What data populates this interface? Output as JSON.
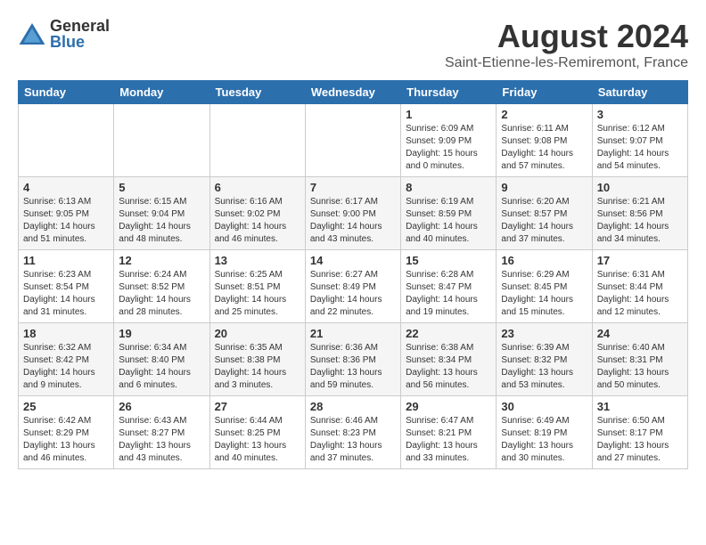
{
  "logo": {
    "general": "General",
    "blue": "Blue"
  },
  "title": "August 2024",
  "location": "Saint-Etienne-les-Remiremont, France",
  "days_of_week": [
    "Sunday",
    "Monday",
    "Tuesday",
    "Wednesday",
    "Thursday",
    "Friday",
    "Saturday"
  ],
  "weeks": [
    [
      {
        "day": "",
        "info": ""
      },
      {
        "day": "",
        "info": ""
      },
      {
        "day": "",
        "info": ""
      },
      {
        "day": "",
        "info": ""
      },
      {
        "day": "1",
        "info": "Sunrise: 6:09 AM\nSunset: 9:09 PM\nDaylight: 15 hours\nand 0 minutes."
      },
      {
        "day": "2",
        "info": "Sunrise: 6:11 AM\nSunset: 9:08 PM\nDaylight: 14 hours\nand 57 minutes."
      },
      {
        "day": "3",
        "info": "Sunrise: 6:12 AM\nSunset: 9:07 PM\nDaylight: 14 hours\nand 54 minutes."
      }
    ],
    [
      {
        "day": "4",
        "info": "Sunrise: 6:13 AM\nSunset: 9:05 PM\nDaylight: 14 hours\nand 51 minutes."
      },
      {
        "day": "5",
        "info": "Sunrise: 6:15 AM\nSunset: 9:04 PM\nDaylight: 14 hours\nand 48 minutes."
      },
      {
        "day": "6",
        "info": "Sunrise: 6:16 AM\nSunset: 9:02 PM\nDaylight: 14 hours\nand 46 minutes."
      },
      {
        "day": "7",
        "info": "Sunrise: 6:17 AM\nSunset: 9:00 PM\nDaylight: 14 hours\nand 43 minutes."
      },
      {
        "day": "8",
        "info": "Sunrise: 6:19 AM\nSunset: 8:59 PM\nDaylight: 14 hours\nand 40 minutes."
      },
      {
        "day": "9",
        "info": "Sunrise: 6:20 AM\nSunset: 8:57 PM\nDaylight: 14 hours\nand 37 minutes."
      },
      {
        "day": "10",
        "info": "Sunrise: 6:21 AM\nSunset: 8:56 PM\nDaylight: 14 hours\nand 34 minutes."
      }
    ],
    [
      {
        "day": "11",
        "info": "Sunrise: 6:23 AM\nSunset: 8:54 PM\nDaylight: 14 hours\nand 31 minutes."
      },
      {
        "day": "12",
        "info": "Sunrise: 6:24 AM\nSunset: 8:52 PM\nDaylight: 14 hours\nand 28 minutes."
      },
      {
        "day": "13",
        "info": "Sunrise: 6:25 AM\nSunset: 8:51 PM\nDaylight: 14 hours\nand 25 minutes."
      },
      {
        "day": "14",
        "info": "Sunrise: 6:27 AM\nSunset: 8:49 PM\nDaylight: 14 hours\nand 22 minutes."
      },
      {
        "day": "15",
        "info": "Sunrise: 6:28 AM\nSunset: 8:47 PM\nDaylight: 14 hours\nand 19 minutes."
      },
      {
        "day": "16",
        "info": "Sunrise: 6:29 AM\nSunset: 8:45 PM\nDaylight: 14 hours\nand 15 minutes."
      },
      {
        "day": "17",
        "info": "Sunrise: 6:31 AM\nSunset: 8:44 PM\nDaylight: 14 hours\nand 12 minutes."
      }
    ],
    [
      {
        "day": "18",
        "info": "Sunrise: 6:32 AM\nSunset: 8:42 PM\nDaylight: 14 hours\nand 9 minutes."
      },
      {
        "day": "19",
        "info": "Sunrise: 6:34 AM\nSunset: 8:40 PM\nDaylight: 14 hours\nand 6 minutes."
      },
      {
        "day": "20",
        "info": "Sunrise: 6:35 AM\nSunset: 8:38 PM\nDaylight: 14 hours\nand 3 minutes."
      },
      {
        "day": "21",
        "info": "Sunrise: 6:36 AM\nSunset: 8:36 PM\nDaylight: 13 hours\nand 59 minutes."
      },
      {
        "day": "22",
        "info": "Sunrise: 6:38 AM\nSunset: 8:34 PM\nDaylight: 13 hours\nand 56 minutes."
      },
      {
        "day": "23",
        "info": "Sunrise: 6:39 AM\nSunset: 8:32 PM\nDaylight: 13 hours\nand 53 minutes."
      },
      {
        "day": "24",
        "info": "Sunrise: 6:40 AM\nSunset: 8:31 PM\nDaylight: 13 hours\nand 50 minutes."
      }
    ],
    [
      {
        "day": "25",
        "info": "Sunrise: 6:42 AM\nSunset: 8:29 PM\nDaylight: 13 hours\nand 46 minutes."
      },
      {
        "day": "26",
        "info": "Sunrise: 6:43 AM\nSunset: 8:27 PM\nDaylight: 13 hours\nand 43 minutes."
      },
      {
        "day": "27",
        "info": "Sunrise: 6:44 AM\nSunset: 8:25 PM\nDaylight: 13 hours\nand 40 minutes."
      },
      {
        "day": "28",
        "info": "Sunrise: 6:46 AM\nSunset: 8:23 PM\nDaylight: 13 hours\nand 37 minutes."
      },
      {
        "day": "29",
        "info": "Sunrise: 6:47 AM\nSunset: 8:21 PM\nDaylight: 13 hours\nand 33 minutes."
      },
      {
        "day": "30",
        "info": "Sunrise: 6:49 AM\nSunset: 8:19 PM\nDaylight: 13 hours\nand 30 minutes."
      },
      {
        "day": "31",
        "info": "Sunrise: 6:50 AM\nSunset: 8:17 PM\nDaylight: 13 hours\nand 27 minutes."
      }
    ]
  ]
}
